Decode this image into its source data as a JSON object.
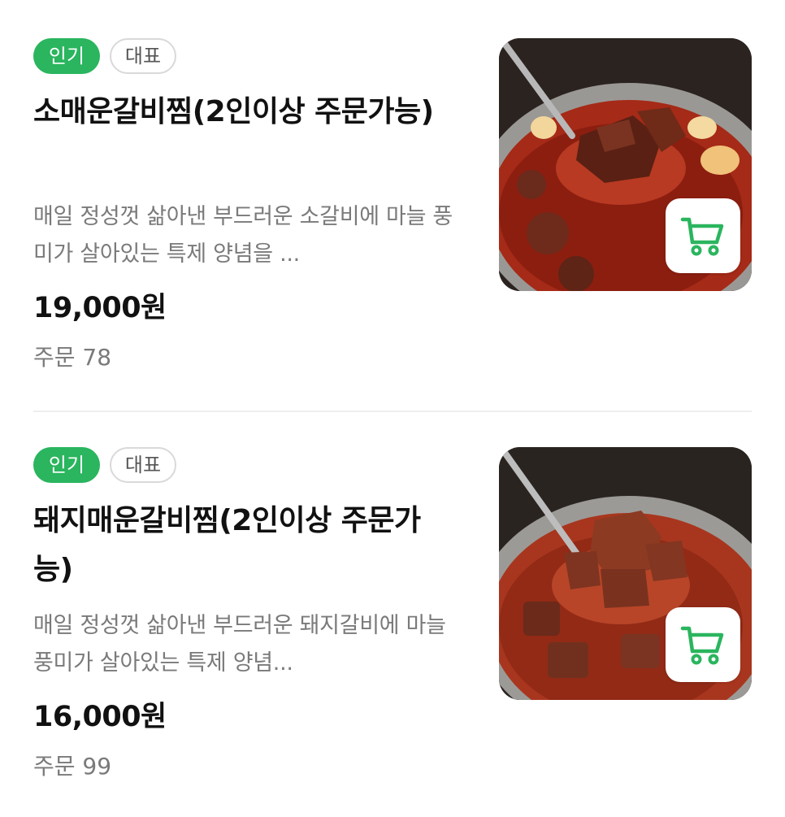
{
  "menu": {
    "items": [
      {
        "badges": {
          "popular": "인기",
          "signature": "대표"
        },
        "title": "소매운갈비찜(2인이상 주문가능)",
        "description": "매일 정성껏 삶아낸 부드러운 소갈비에 마늘 풍미가 살아있는 특제 양념을 ...",
        "price": "19,000원",
        "orders": "주문 78",
        "image_alt": "spicy beef short rib stew in a pot with a ladle",
        "cart_icon": "shopping-cart-icon"
      },
      {
        "badges": {
          "popular": "인기",
          "signature": "대표"
        },
        "title": "돼지매운갈비찜(2인이상 주문가능)",
        "description": "매일 정성껏 삶아낸 부드러운 돼지갈비에 마늘 풍미가 살아있는 특제 양념...",
        "price": "16,000원",
        "orders": "주문 99",
        "image_alt": "spicy pork rib stew in a pot with a ladle",
        "cart_icon": "shopping-cart-icon"
      }
    ]
  },
  "colors": {
    "popular_badge": "#2ab55e",
    "cart_icon": "#2ab55e",
    "secondary_text": "#7a7a7a",
    "divider": "#eeeeee"
  }
}
